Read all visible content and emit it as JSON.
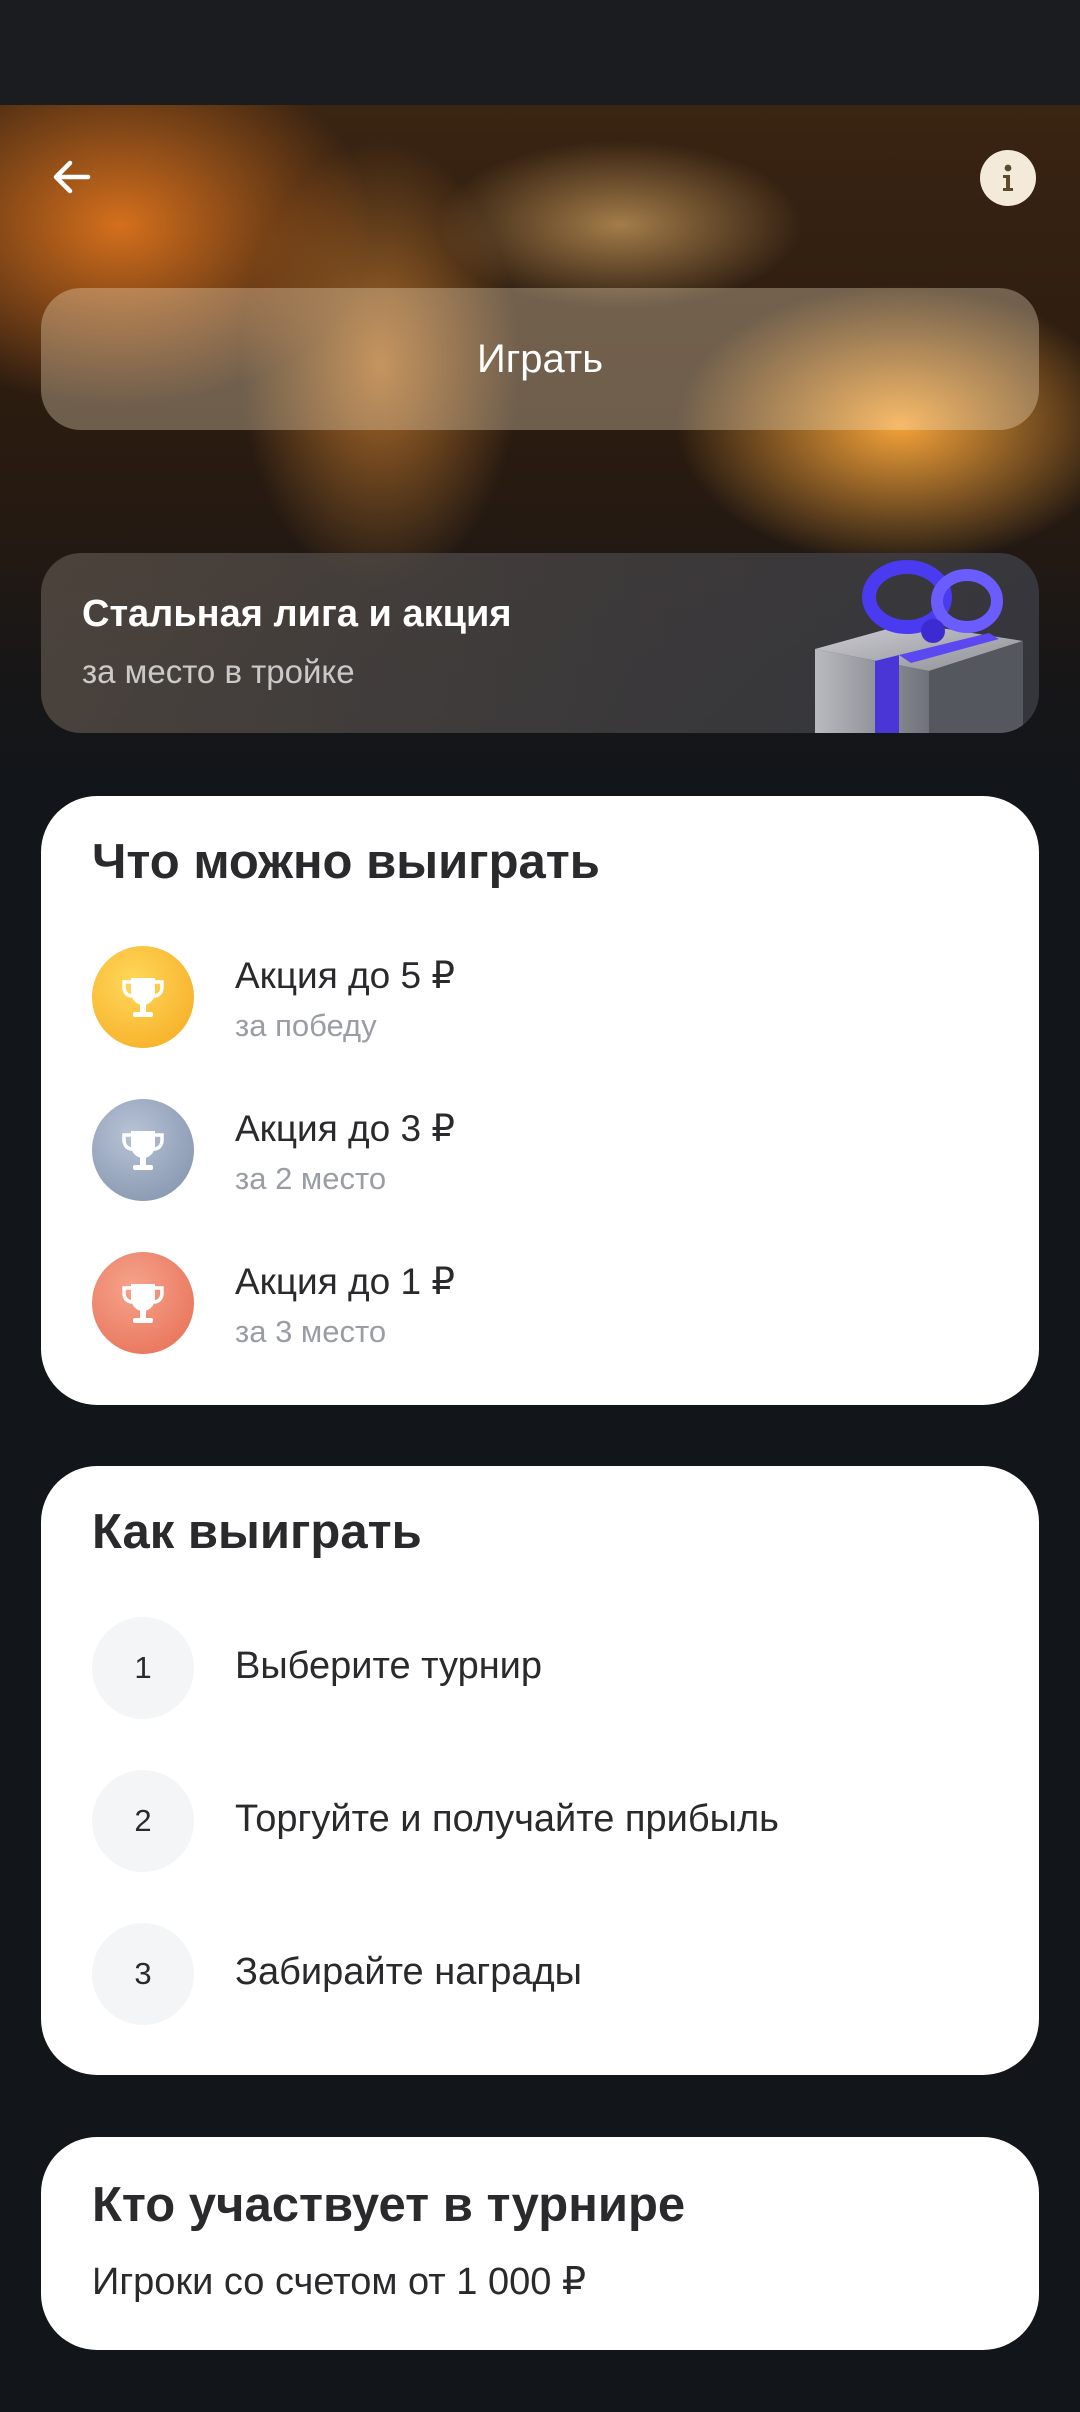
{
  "header": {
    "back_icon": "arrow-left-icon",
    "info_icon": "info-icon",
    "play_label": "Играть"
  },
  "promo": {
    "title": "Стальная лига и акция",
    "subtitle": "за место в тройке",
    "image_icon": "gift-box-icon"
  },
  "prizes": {
    "title": "Что можно выиграть",
    "items": [
      {
        "title": "Акция до 5 ₽",
        "subtitle": "за победу",
        "icon": "trophy-icon",
        "color": "#F8B924"
      },
      {
        "title": "Акция до 3 ₽",
        "subtitle": "за 2 место",
        "icon": "trophy-icon",
        "color": "#8D9CB4"
      },
      {
        "title": "Акция до 1 ₽",
        "subtitle": "за 3 место",
        "icon": "trophy-icon",
        "color": "#EE7C62"
      }
    ]
  },
  "how_to_win": {
    "title": "Как выиграть",
    "steps": [
      {
        "number": "1",
        "label": "Выберите турнир"
      },
      {
        "number": "2",
        "label": "Торгуйте и получайте прибыль"
      },
      {
        "number": "3",
        "label": "Забирайте награды"
      }
    ]
  },
  "participants": {
    "title": "Кто участвует в турнире",
    "text": "Игроки со счетом от 1 000 ₽"
  }
}
